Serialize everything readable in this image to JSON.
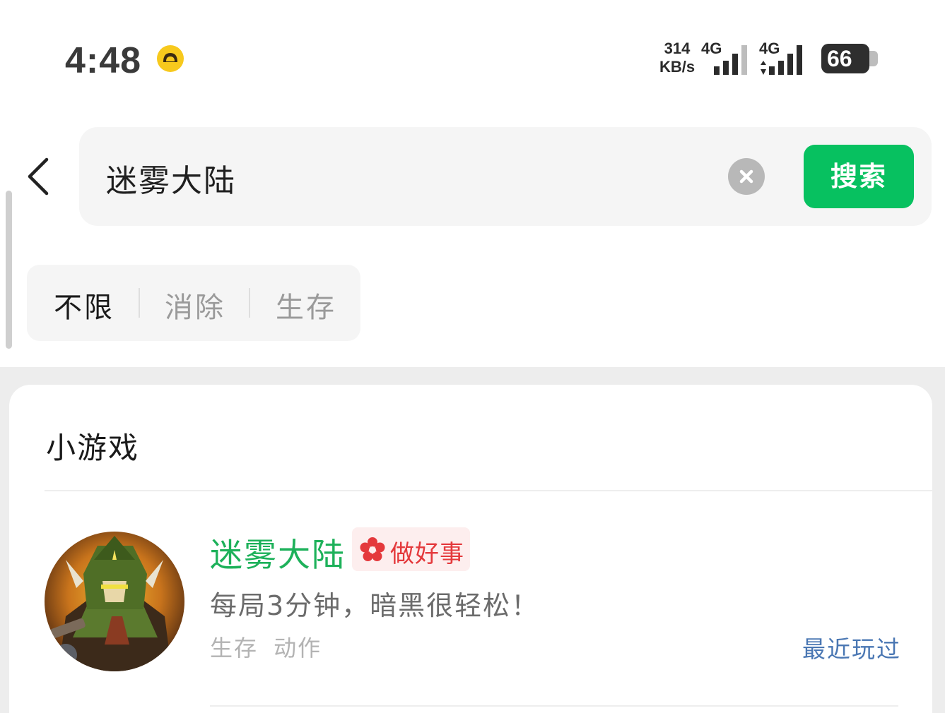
{
  "status_bar": {
    "time": "4:48",
    "net_speed_value": "314",
    "net_speed_unit": "KB/s",
    "sim1_label": "4G",
    "sim2_label": "4G",
    "battery_level": "66",
    "status_icon": "face-icon"
  },
  "search": {
    "query": "迷雾大陆",
    "button_label": "搜索",
    "clear_icon": "close-circle-icon",
    "back_icon": "chevron-left-icon"
  },
  "filters": [
    {
      "label": "不限",
      "active": true
    },
    {
      "label": "消除",
      "active": false
    },
    {
      "label": "生存",
      "active": false
    }
  ],
  "results": {
    "section_title": "小游戏",
    "items": [
      {
        "name": "迷雾大陆",
        "badge_label": "做好事",
        "badge_icon": "flower-icon",
        "description": "每局3分钟，暗黑很轻松！",
        "tags": "生存 动作",
        "action_label": "最近玩过"
      }
    ]
  },
  "colors": {
    "accent": "#07c160",
    "name_green": "#1db15a",
    "badge_red": "#e4393c",
    "link_blue": "#4a77b3"
  }
}
